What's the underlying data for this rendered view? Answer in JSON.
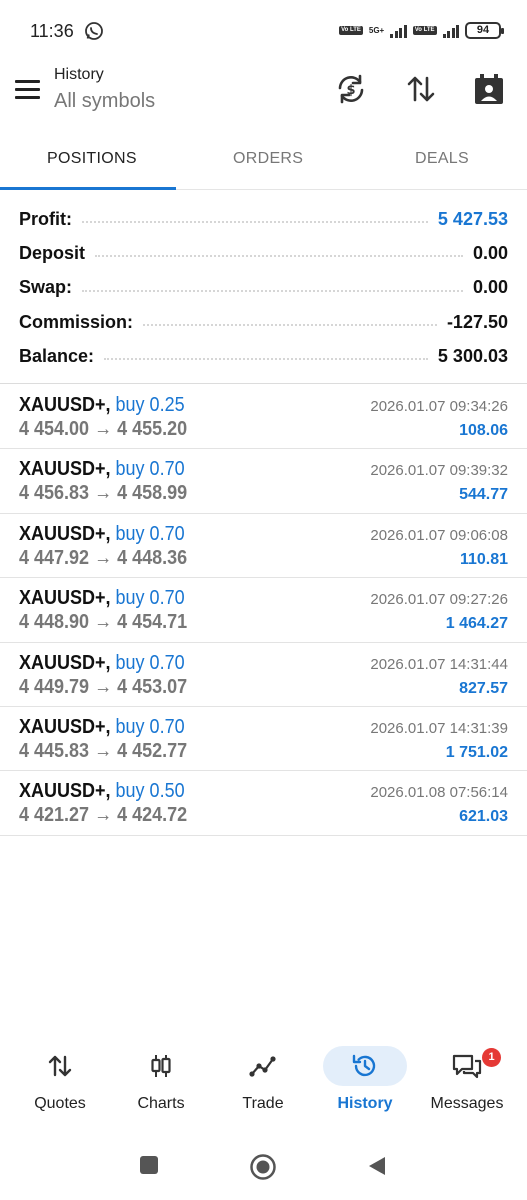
{
  "status_bar": {
    "time": "11:36",
    "sim1_badge": "Vo LTE",
    "sim1_net": "5G+",
    "sim2_badge": "Vo LTE",
    "battery": "94"
  },
  "header": {
    "title": "History",
    "subtitle": "All symbols"
  },
  "tabs": [
    {
      "label": "POSITIONS",
      "active": true
    },
    {
      "label": "ORDERS",
      "active": false
    },
    {
      "label": "DEALS",
      "active": false
    }
  ],
  "summary": [
    {
      "label": "Profit:",
      "value": "5 427.53",
      "highlight": true
    },
    {
      "label": "Deposit",
      "value": "0.00",
      "highlight": false
    },
    {
      "label": "Swap:",
      "value": "0.00",
      "highlight": false
    },
    {
      "label": "Commission:",
      "value": "-127.50",
      "highlight": false
    },
    {
      "label": "Balance:",
      "value": "5 300.03",
      "highlight": false
    }
  ],
  "positions": [
    {
      "symbol": "XAUUSD+,",
      "type": "buy 0.25",
      "open": "4 454.00",
      "close": "4 455.20",
      "time": "2026.01.07 09:34:26",
      "profit": "108.06"
    },
    {
      "symbol": "XAUUSD+,",
      "type": "buy 0.70",
      "open": "4 456.83",
      "close": "4 458.99",
      "time": "2026.01.07 09:39:32",
      "profit": "544.77"
    },
    {
      "symbol": "XAUUSD+,",
      "type": "buy 0.70",
      "open": "4 447.92",
      "close": "4 448.36",
      "time": "2026.01.07 09:06:08",
      "profit": "110.81"
    },
    {
      "symbol": "XAUUSD+,",
      "type": "buy 0.70",
      "open": "4 448.90",
      "close": "4 454.71",
      "time": "2026.01.07 09:27:26",
      "profit": "1 464.27"
    },
    {
      "symbol": "XAUUSD+,",
      "type": "buy 0.70",
      "open": "4 449.79",
      "close": "4 453.07",
      "time": "2026.01.07 14:31:44",
      "profit": "827.57"
    },
    {
      "symbol": "XAUUSD+,",
      "type": "buy 0.70",
      "open": "4 445.83",
      "close": "4 452.77",
      "time": "2026.01.07 14:31:39",
      "profit": "1 751.02"
    },
    {
      "symbol": "XAUUSD+,",
      "type": "buy 0.50",
      "open": "4 421.27",
      "close": "4 424.72",
      "time": "2026.01.08 07:56:14",
      "profit": "621.03"
    }
  ],
  "price_arrow": "→",
  "bottom_nav": [
    {
      "label": "Quotes",
      "icon": "quotes-arrows-icon",
      "active": false
    },
    {
      "label": "Charts",
      "icon": "candlestick-icon",
      "active": false
    },
    {
      "label": "Trade",
      "icon": "trade-line-icon",
      "active": false
    },
    {
      "label": "History",
      "icon": "history-clock-icon",
      "active": true
    },
    {
      "label": "Messages",
      "icon": "messages-chat-icon",
      "active": false,
      "badge": "1"
    }
  ],
  "colors": {
    "accent": "#1976d2",
    "badge": "#e53935",
    "muted": "#777777"
  }
}
